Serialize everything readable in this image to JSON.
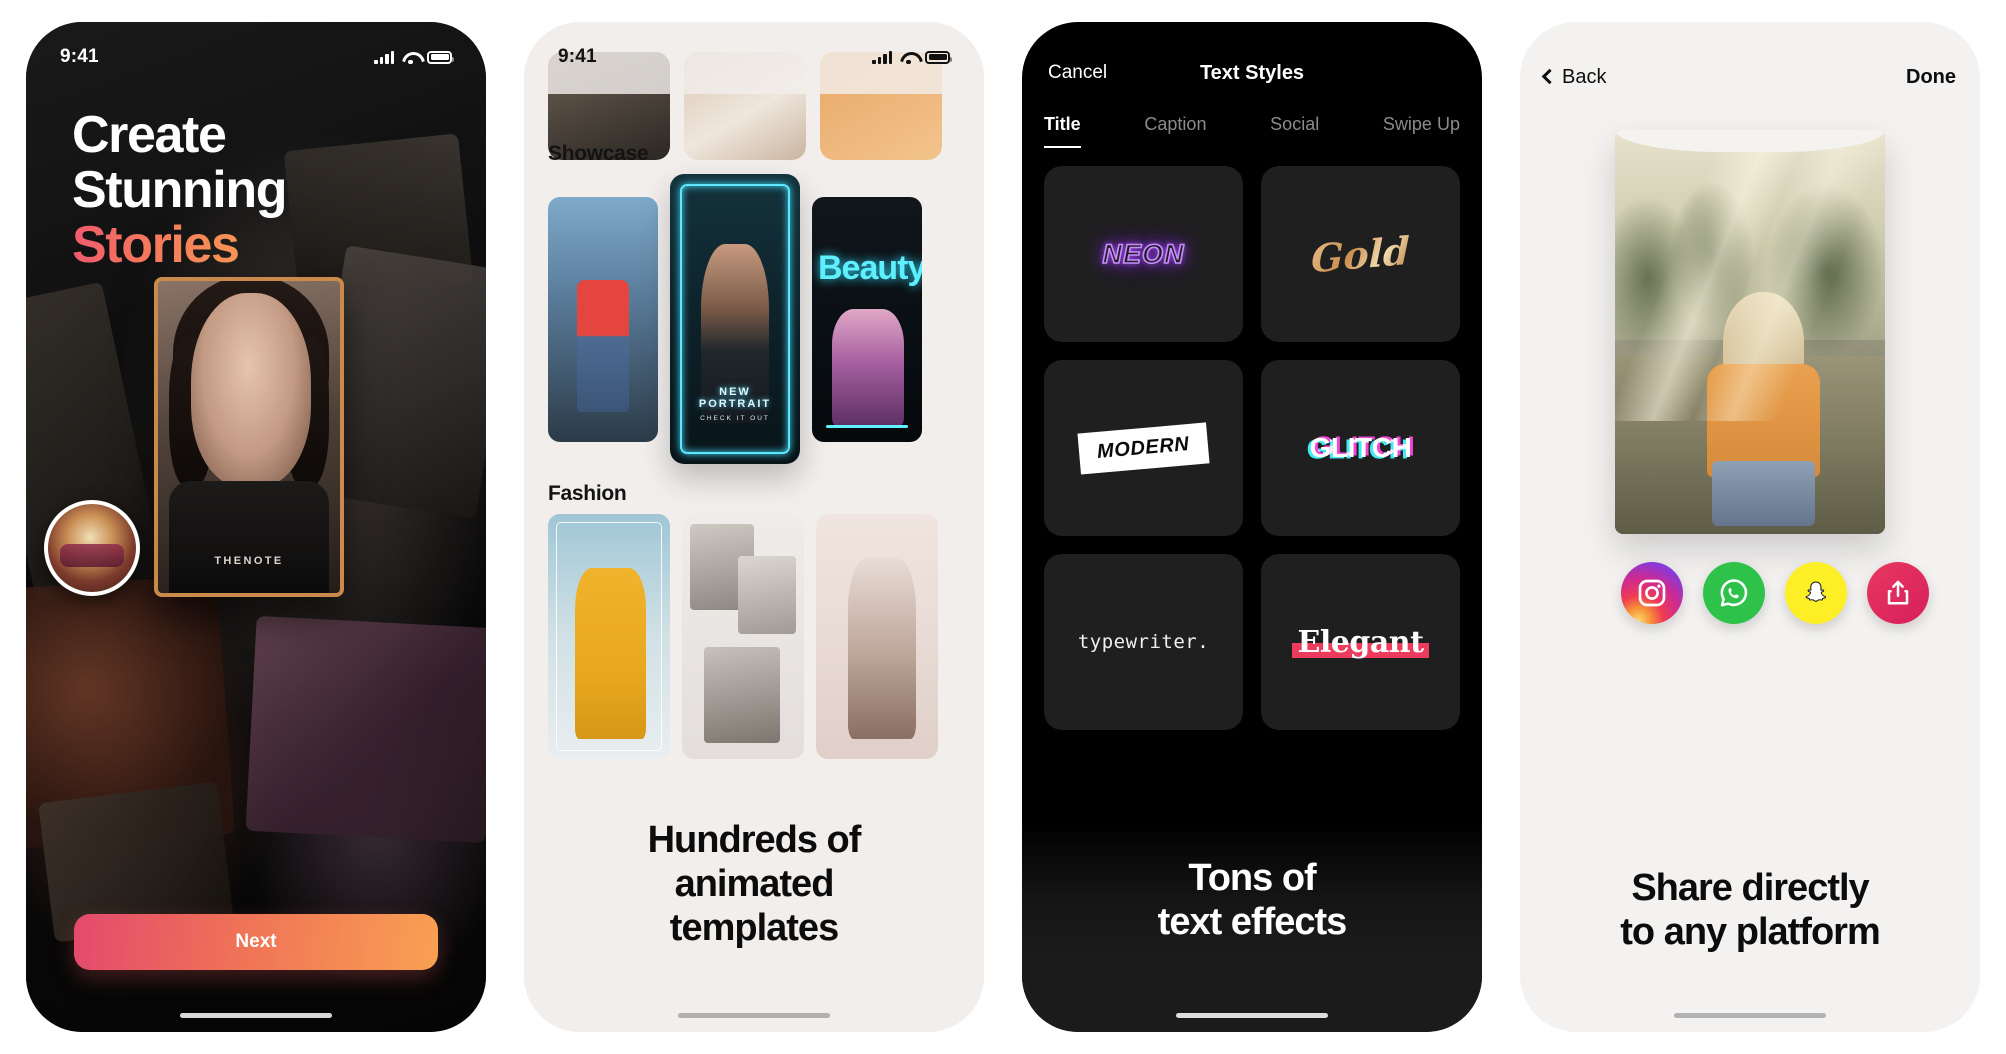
{
  "screens": [
    {
      "id": "onboarding-hero",
      "status_bar": {
        "time": "9:41",
        "icons": [
          "signal-bars-icon",
          "wifi-icon",
          "battery-icon"
        ]
      },
      "title_lines": [
        "Create",
        "Stunning"
      ],
      "title_accent": "Stories",
      "accent_gradient": [
        "#f05a6e",
        "#f79455"
      ],
      "hero_card_word": "THENOTE",
      "primary_button": "Next",
      "button_gradient": [
        "#e44a6d",
        "#f9a052"
      ]
    },
    {
      "id": "templates-browser",
      "status_bar": {
        "time": "9:41",
        "icons": [
          "signal-bars-icon",
          "wifi-icon",
          "battery-icon"
        ]
      },
      "sections": [
        {
          "label": "Showcase"
        },
        {
          "label": "Fashion"
        }
      ],
      "featured_card": {
        "line1": "NEW",
        "line2": "PORTRAIT",
        "line3": "CHECK IT OUT"
      },
      "neon_card_text": "Beauty",
      "caption_lines": [
        "Hundreds of",
        "animated",
        "templates"
      ]
    },
    {
      "id": "text-styles",
      "nav": {
        "cancel": "Cancel",
        "title": "Text Styles"
      },
      "tabs": [
        {
          "label": "Title",
          "active": true
        },
        {
          "label": "Caption",
          "active": false
        },
        {
          "label": "Social",
          "active": false
        },
        {
          "label": "Swipe Up",
          "active": false
        }
      ],
      "styles": [
        {
          "name": "neon",
          "label": "NEON",
          "color": "#c78dff"
        },
        {
          "name": "gold",
          "label": "Gold",
          "color": "#d9a465"
        },
        {
          "name": "modern",
          "label": "MODERN",
          "color": "#ffffff"
        },
        {
          "name": "glitch",
          "label": "GLITCH",
          "color": "#ffffff"
        },
        {
          "name": "typewriter",
          "label": "typewriter.",
          "color": "#f2f0ee"
        },
        {
          "name": "elegant",
          "label": "Elegant",
          "color": "#ec3b5c"
        }
      ],
      "caption_lines": [
        "Tons of",
        "text effects"
      ]
    },
    {
      "id": "share-screen",
      "nav": {
        "back": "Back",
        "done": "Done"
      },
      "share_targets": [
        {
          "name": "instagram",
          "icon": "instagram-icon",
          "color": "#cc2a92"
        },
        {
          "name": "whatsapp",
          "icon": "whatsapp-icon",
          "color": "#2fc24a"
        },
        {
          "name": "snapchat",
          "icon": "snapchat-icon",
          "color": "#fcef26"
        },
        {
          "name": "more",
          "icon": "share-icon",
          "color": "#e8385f"
        }
      ],
      "caption_lines": [
        "Share directly",
        "to any platform"
      ]
    }
  ]
}
